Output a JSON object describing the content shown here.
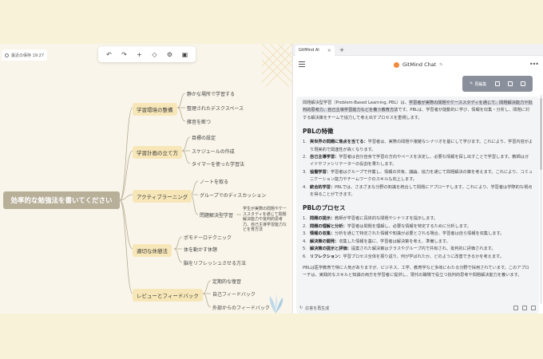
{
  "mindmap": {
    "save_status": "最近の保存 19:27",
    "root": "効率的な勉強法を書いてください",
    "branches": [
      {
        "label": "学習環境の整備",
        "children": [
          "静かな場所で学習する",
          "整理されたデスクスペース",
          "雑音を断つ"
        ]
      },
      {
        "label": "学習計画の立て方",
        "children": [
          "目標の設定",
          "スケジュールの作成",
          "タイマーを使った学習法"
        ]
      },
      {
        "label": "アクティブラーニング",
        "children": [
          "ノートを取る",
          "グループでのディスカッション",
          "問題解決型学習"
        ]
      },
      {
        "label": "適切な休憩法",
        "children": [
          "ポモドーロテクニック",
          "体を動かす休憩",
          "脳をリフレッシュさせる方法"
        ]
      },
      {
        "label": "レビューとフィードバック",
        "children": [
          "定期的な復習",
          "自己フィードバック",
          "外部からのフィードバック"
        ]
      }
    ],
    "pbl_note": "学生が実際の問題やケーススタディを通じて問題解決能力や批判的思考力、自己主導学習能力などを育方法"
  },
  "toolbar": {
    "undo": "↶",
    "redo": "↷",
    "add": "+",
    "style": "◇",
    "format": "⚙",
    "image": "▣"
  },
  "panel": {
    "tab_title": "GitMind AI",
    "tab_close": "×",
    "tab_add": "+",
    "title": "GitMind Chat",
    "model_tag": "⇆",
    "more": "•••",
    "actions": {
      "edit": "再編集"
    },
    "intro_plain": "問題解決型学習（Problem-Based Learning, PBL）は、",
    "intro_hl": "学習者が実際の問題やケーススタディを通じて、問題解決能力や批判的思考力、自己主導学習能力などを養う教育方法",
    "intro_rest": "です。PBLは、学習者が能動的に学び、情報を収集・分析し、問題に対する解決策をチームで協力して考え出すプロセスを重視します。",
    "features_heading": "PBLの特徴",
    "features": [
      {
        "num": "1.",
        "title": "実世界の問題に焦点を当てる：",
        "text": "学習者は、実際の問題や複雑なシナリオを基にして学びます。これにより、学習内容がより現実的で関連性が高くなります。"
      },
      {
        "num": "2.",
        "title": "自己主導学習：",
        "text": "学習者は自分自身で学習の方向やペースを決定し、必要な情報を探し出すことで学習します。教師はガイドやファシリテーターの役割を果たします。"
      },
      {
        "num": "3.",
        "title": "協働学習：",
        "text": "学習者はグループで作業し、情報の共有、議論、協力を通じて問題解決の策を考えます。これにより、コミュニケーション能力やチームワークのスキルも向上します。"
      },
      {
        "num": "4.",
        "title": "統合的学習：",
        "text": "PBLでは、さまざまな分野の知識を統合して問題にアプローチします。これにより、学習者は学際的な視点を得ることができます。"
      }
    ],
    "process_heading": "PBLのプロセス",
    "process": [
      {
        "num": "1.",
        "title": "問題の提示：",
        "text": "教師が学習者に具体的な問題やシナリオを提示します。"
      },
      {
        "num": "2.",
        "title": "問題の理解と分析：",
        "text": "学習者は問題を理解し、必要な情報を特定するために分析します。"
      },
      {
        "num": "3.",
        "title": "情報の収集：",
        "text": "分析を通じて特定された情報や知識が必要とされる場合、学習者は自ら情報を収集します。"
      },
      {
        "num": "4.",
        "title": "解決策の開発：",
        "text": "収集した情報を基に、学習者は解決策を考え、準備します。"
      },
      {
        "num": "5.",
        "title": "解決策の提示と評価：",
        "text": "提案された解決策はクラスやグループ内で共有され、批判的に評価されます。"
      },
      {
        "num": "6.",
        "title": "リフレクション：",
        "text": "学習プロセス全体を振り返り、何が学ばれたか、どのように改善できるかを考えます。"
      }
    ],
    "closing": "PBLは医学教育で特に人気がありますが、ビジネス、工学、教育学など多岐にわたる分野で採用されています。このアプローチは、実践的なスキルと知識の両方を学習者に提供し、現代の職場で役立つ批判的思考や問題解決能力を養います。",
    "regenerate": "応答を再生成"
  }
}
